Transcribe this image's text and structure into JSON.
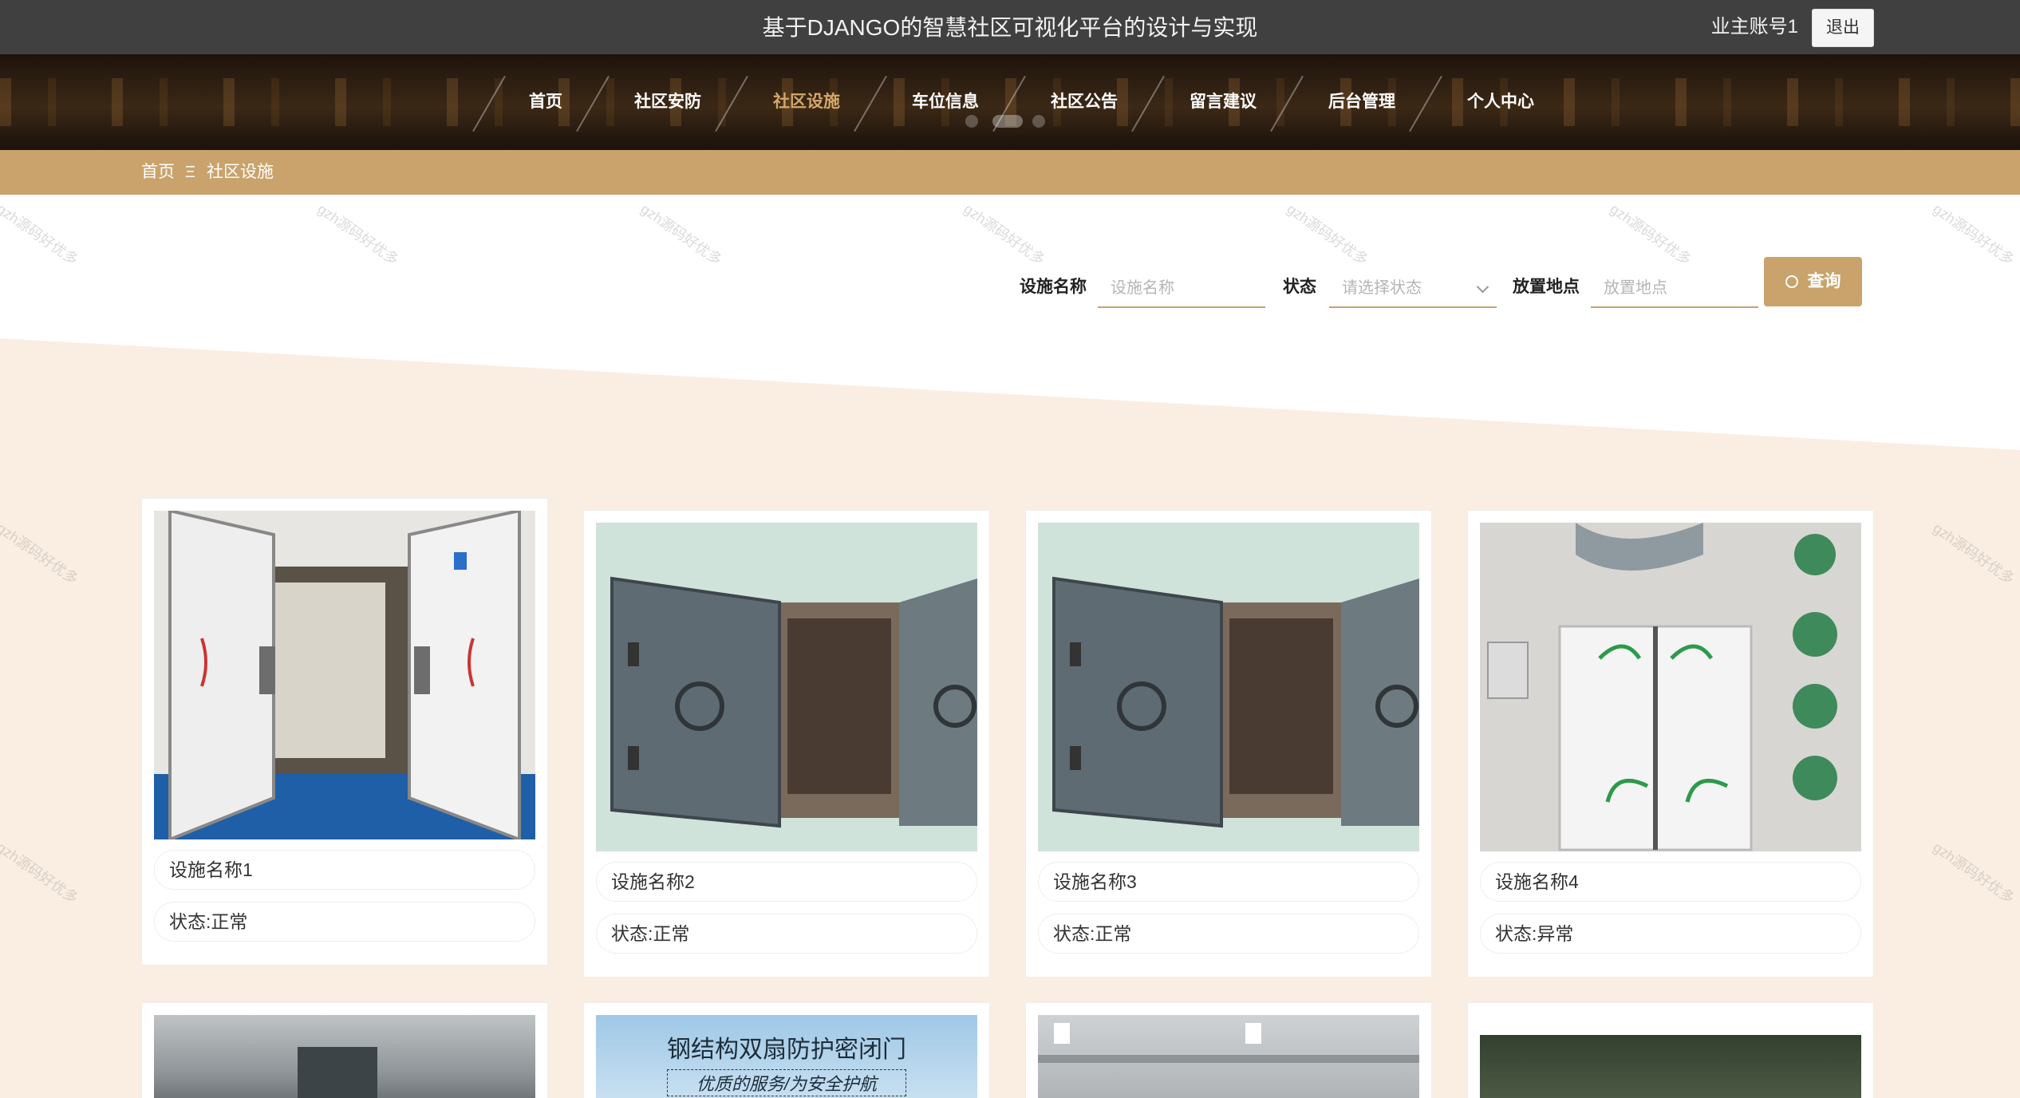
{
  "header": {
    "site_title": "基于DJANGO的智慧社区可视化平台的设计与实现",
    "account": "业主账号1",
    "logout_label": "退出"
  },
  "nav": {
    "items": [
      {
        "label": "首页",
        "active": false
      },
      {
        "label": "社区安防",
        "active": false
      },
      {
        "label": "社区设施",
        "active": true
      },
      {
        "label": "车位信息",
        "active": false
      },
      {
        "label": "社区公告",
        "active": false
      },
      {
        "label": "留言建议",
        "active": false
      },
      {
        "label": "后台管理",
        "active": false
      },
      {
        "label": "个人中心",
        "active": false
      }
    ]
  },
  "breadcrumb": {
    "home": "首页",
    "separator": "Ξ",
    "current": "社区设施"
  },
  "search": {
    "name_label": "设施名称",
    "name_placeholder": "设施名称",
    "status_label": "状态",
    "status_placeholder": "请选择状态",
    "location_label": "放置地点",
    "location_placeholder": "放置地点",
    "button_label": "查询"
  },
  "watermark": "gzh源码好优多",
  "facilities": [
    {
      "name": "设施名称1",
      "status": "状态:正常"
    },
    {
      "name": "设施名称2",
      "status": "状态:正常"
    },
    {
      "name": "设施名称3",
      "status": "状态:正常"
    },
    {
      "name": "设施名称4",
      "status": "状态:异常"
    }
  ],
  "bottom_card_text": {
    "title": "钢结构双扇防护密闭门",
    "subtitle": "优质的服务/为安全护航"
  },
  "colors": {
    "accent": "#c9a36b",
    "topbar": "#404040",
    "beige": "#faeee2"
  }
}
